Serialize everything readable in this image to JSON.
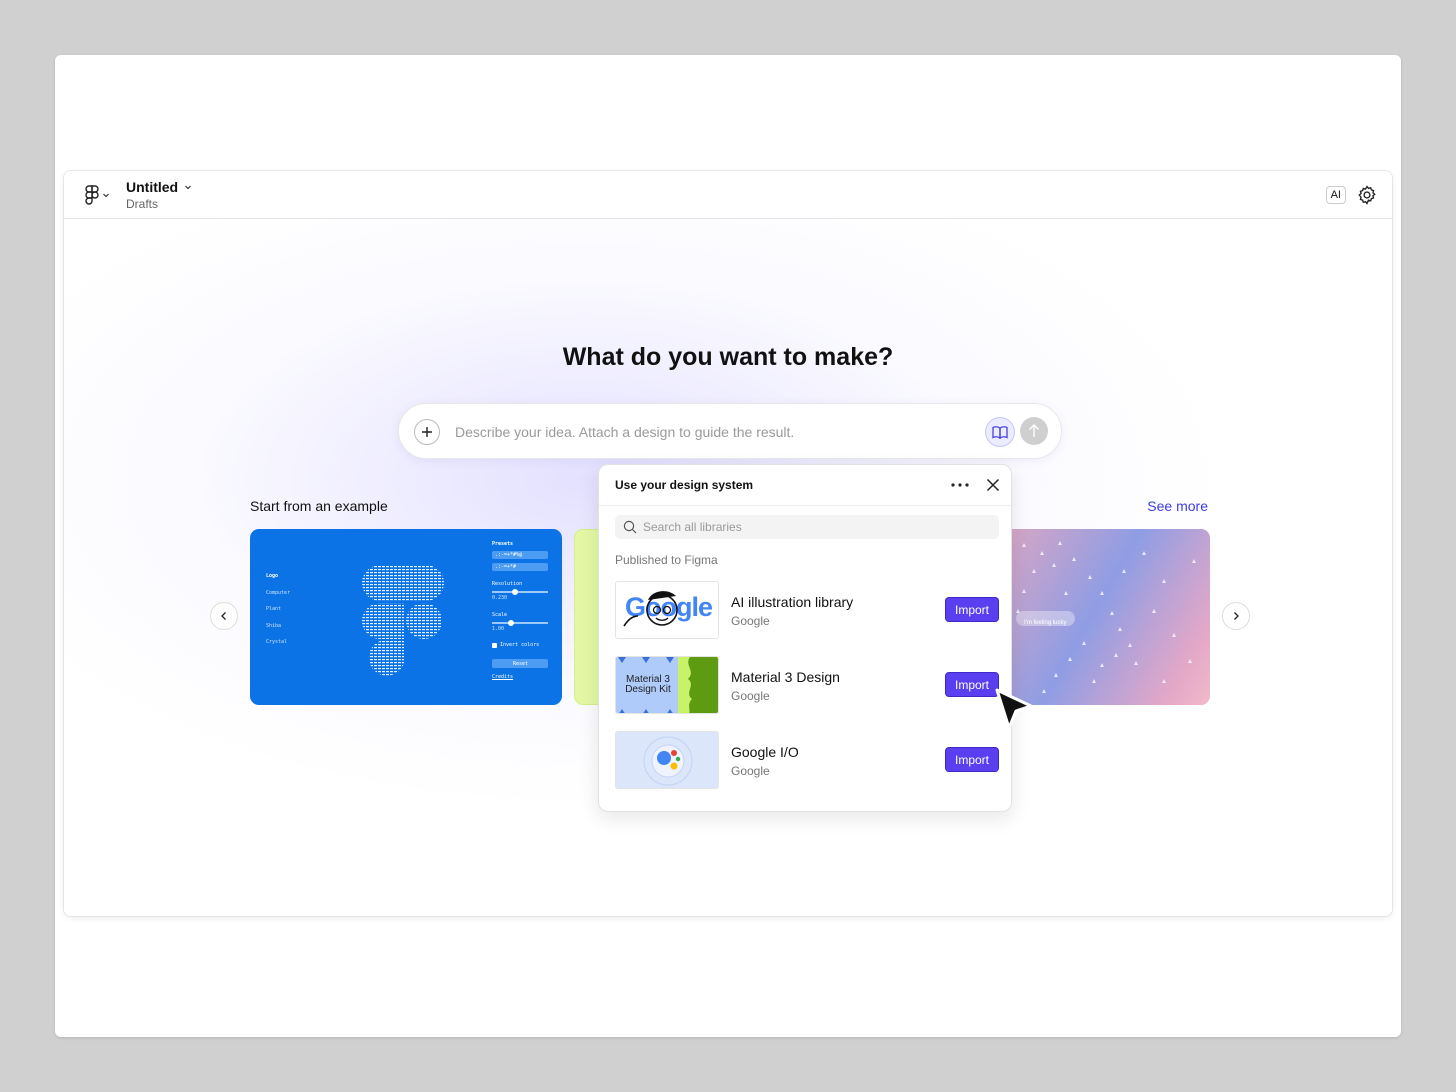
{
  "header": {
    "file_title": "Untitled",
    "file_location": "Drafts",
    "ai_badge": "AI"
  },
  "main": {
    "heading": "What do you want to make?",
    "prompt_placeholder": "Describe your idea. Attach a design to guide the result.",
    "section_label": "Start from an example",
    "see_more": "See more"
  },
  "example_card_blue": {
    "menu_items": [
      "Logo",
      "Computer",
      "Plant",
      "Shiba",
      "Crystal"
    ],
    "presets_label": "Presets",
    "preset_1": ".:-=+*#%@",
    "preset_2": ".:-=+*#",
    "resolution_label": "Resolution",
    "resolution_value": "0.230",
    "scale_label": "Scale",
    "scale_value": "1.00",
    "invert_label": "Invert colors",
    "reset_label": "Reset",
    "credits_label": "Credits"
  },
  "example_card_pink": {
    "chip_label": "I'm feeling lucky"
  },
  "popover": {
    "title": "Use your design system",
    "search_placeholder": "Search all libraries",
    "section_label": "Published to Figma",
    "libraries": [
      {
        "name": "AI illustration library",
        "org": "Google",
        "action": "Import",
        "thumb_text": "Google"
      },
      {
        "name": "Material 3 Design",
        "org": "Google",
        "action": "Import",
        "thumb_text": "Material 3 Design Kit"
      },
      {
        "name": "Google I/O",
        "org": "Google",
        "action": "Import"
      }
    ]
  },
  "colors": {
    "accent": "#5a3ff0",
    "link": "#3b3be6",
    "card_blue": "#0b73e6",
    "card_lime": "#e3f8a5",
    "page_bg": "#d0d0d0"
  },
  "icons": [
    "figma-logo-icon",
    "chevron-down-icon",
    "gear-icon",
    "plus-icon",
    "book-icon",
    "arrow-up-icon",
    "chevron-left-icon",
    "chevron-right-icon",
    "more-icon",
    "close-icon",
    "search-icon",
    "cursor-icon"
  ]
}
